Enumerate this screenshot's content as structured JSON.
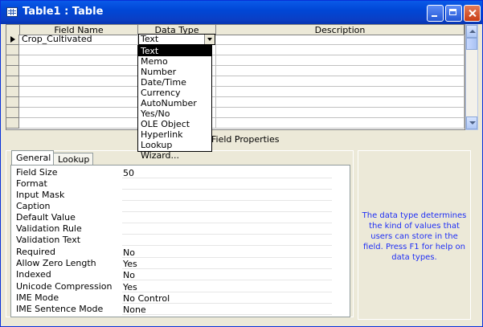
{
  "window": {
    "title": "Table1 : Table"
  },
  "grid": {
    "headers": [
      "Field Name",
      "Data Type",
      "Description"
    ],
    "current_row": {
      "field_name": "Crop_Cultivated",
      "data_type": "Text",
      "description": ""
    }
  },
  "dropdown": {
    "options": [
      "Text",
      "Memo",
      "Number",
      "Date/Time",
      "Currency",
      "AutoNumber",
      "Yes/No",
      "OLE Object",
      "Hyperlink",
      "Lookup Wizard..."
    ],
    "selected": "Text"
  },
  "field_properties": {
    "title": "Field Properties",
    "tabs": [
      "General",
      "Lookup"
    ],
    "active_tab": "General",
    "properties": [
      {
        "label": "Field Size",
        "value": "50"
      },
      {
        "label": "Format",
        "value": ""
      },
      {
        "label": "Input Mask",
        "value": ""
      },
      {
        "label": "Caption",
        "value": ""
      },
      {
        "label": "Default Value",
        "value": ""
      },
      {
        "label": "Validation Rule",
        "value": ""
      },
      {
        "label": "Validation Text",
        "value": ""
      },
      {
        "label": "Required",
        "value": "No"
      },
      {
        "label": "Allow Zero Length",
        "value": "Yes"
      },
      {
        "label": "Indexed",
        "value": "No"
      },
      {
        "label": "Unicode Compression",
        "value": "Yes"
      },
      {
        "label": "IME Mode",
        "value": "No Control"
      },
      {
        "label": "IME Sentence Mode",
        "value": "None"
      }
    ]
  },
  "help": {
    "text": "The data type determines the kind of values that users can store in the field.  Press F1 for help on data types."
  }
}
